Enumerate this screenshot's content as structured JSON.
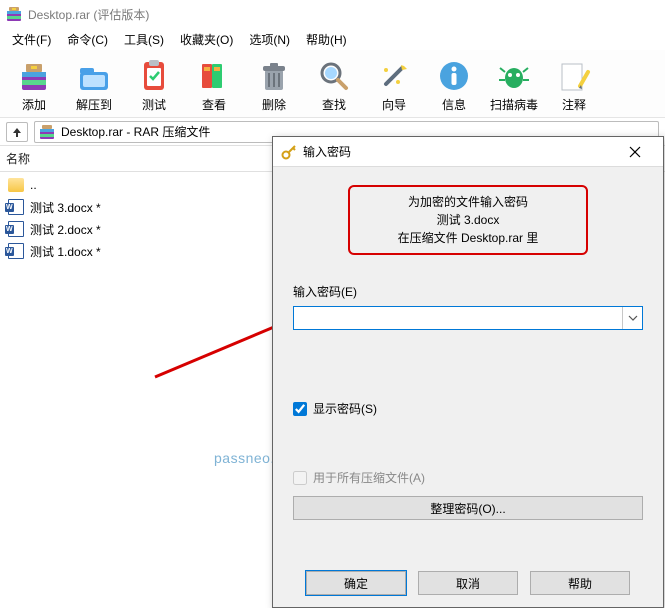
{
  "title": "Desktop.rar (评估版本)",
  "menu": [
    "文件(F)",
    "命令(C)",
    "工具(S)",
    "收藏夹(O)",
    "选项(N)",
    "帮助(H)"
  ],
  "toolbar": [
    {
      "id": "add",
      "label": "添加"
    },
    {
      "id": "extract",
      "label": "解压到"
    },
    {
      "id": "test",
      "label": "测试"
    },
    {
      "id": "view",
      "label": "查看"
    },
    {
      "id": "delete",
      "label": "删除"
    },
    {
      "id": "find",
      "label": "查找"
    },
    {
      "id": "wizard",
      "label": "向导"
    },
    {
      "id": "info",
      "label": "信息"
    },
    {
      "id": "scan",
      "label": "扫描病毒"
    },
    {
      "id": "comment",
      "label": "注释"
    }
  ],
  "path": "Desktop.rar - RAR 压缩文件",
  "listHeader": "名称",
  "files": [
    {
      "name": "..",
      "type": "folder"
    },
    {
      "name": "测试 3.docx *",
      "type": "docx"
    },
    {
      "name": "测试 2.docx *",
      "type": "docx"
    },
    {
      "name": "测试 1.docx *",
      "type": "docx"
    }
  ],
  "dialog": {
    "title": "输入密码",
    "hint1": "为加密的文件输入密码",
    "hint2": "测试 3.docx",
    "hint3": "在压缩文件 Desktop.rar 里",
    "fieldLabel": "输入密码(E)",
    "showPwd": "显示密码(S)",
    "forAll": "用于所有压缩文件(A)",
    "organize": "整理密码(O)...",
    "ok": "确定",
    "cancel": "取消",
    "help": "帮助"
  },
  "watermark": "passneo.cn"
}
